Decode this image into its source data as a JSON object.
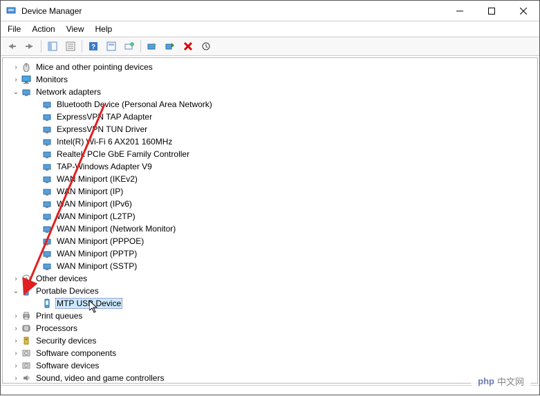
{
  "window": {
    "title": "Device Manager"
  },
  "menu": {
    "file": "File",
    "action": "Action",
    "view": "View",
    "help": "Help"
  },
  "tree": {
    "mice": "Mice and other pointing devices",
    "monitors": "Monitors",
    "network_adapters": "Network adapters",
    "net": {
      "bluetooth": "Bluetooth Device (Personal Area Network)",
      "tap": "ExpressVPN TAP Adapter",
      "tun": "ExpressVPN TUN Driver",
      "wifi": "Intel(R) Wi-Fi 6 AX201 160MHz",
      "realtek": "Realtek PCIe GbE Family Controller",
      "tapwin": "TAP-Windows Adapter V9",
      "wan_ikev2": "WAN Miniport (IKEv2)",
      "wan_ip": "WAN Miniport (IP)",
      "wan_ipv6": "WAN Miniport (IPv6)",
      "wan_l2tp": "WAN Miniport (L2TP)",
      "wan_netmon": "WAN Miniport (Network Monitor)",
      "wan_pppoe": "WAN Miniport (PPPOE)",
      "wan_pptp": "WAN Miniport (PPTP)",
      "wan_sstp": "WAN Miniport (SSTP)"
    },
    "other": "Other devices",
    "portable": "Portable Devices",
    "mtp": "MTP USB Device",
    "print": "Print queues",
    "proc": "Processors",
    "sec": "Security devices",
    "softcomp": "Software components",
    "softdev": "Software devices",
    "sound": "Sound, video and game controllers"
  },
  "watermark": {
    "php": "php",
    "cn": "中文网"
  }
}
